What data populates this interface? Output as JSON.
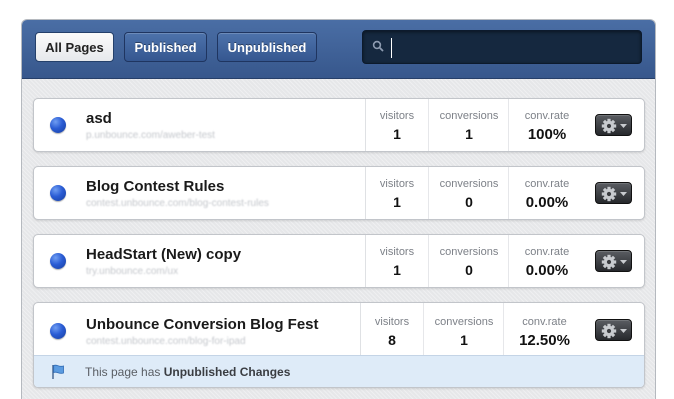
{
  "tabs": [
    {
      "label": "All Pages"
    },
    {
      "label": "Published"
    },
    {
      "label": "Unpublished"
    }
  ],
  "search": {
    "placeholder": "",
    "value": "",
    "icon": "search-icon"
  },
  "labels": {
    "visitors": "visitors",
    "conversions": "conversions",
    "conv_rate": "conv.rate"
  },
  "pages": [
    {
      "title": "asd",
      "url": "p.unbounce.com/aweber-test",
      "visitors": "1",
      "conversions": "1",
      "conv_rate": "100%"
    },
    {
      "title": "Blog Contest Rules",
      "url": "contest.unbounce.com/blog-contest-rules",
      "visitors": "1",
      "conversions": "0",
      "conv_rate": "0.00%"
    },
    {
      "title": "HeadStart (New) copy",
      "url": "try.unbounce.com/ux",
      "visitors": "1",
      "conversions": "0",
      "conv_rate": "0.00%"
    },
    {
      "title": "Unbounce Conversion Blog Fest",
      "url": "contest.unbounce.com/blog-for-ipad",
      "visitors": "8",
      "conversions": "1",
      "conv_rate": "12.50%",
      "notice": {
        "prefix": "This page has ",
        "emphasis": "Unpublished Changes"
      }
    }
  ],
  "colors": {
    "status_published": "#2a5cd4",
    "topbar": "#3f6196",
    "notice_bg": "#deebf8"
  },
  "icons": {
    "status": "status-dot-icon",
    "settings": "gear-icon",
    "dropdown": "caret-down-icon",
    "notice": "flag-icon"
  }
}
